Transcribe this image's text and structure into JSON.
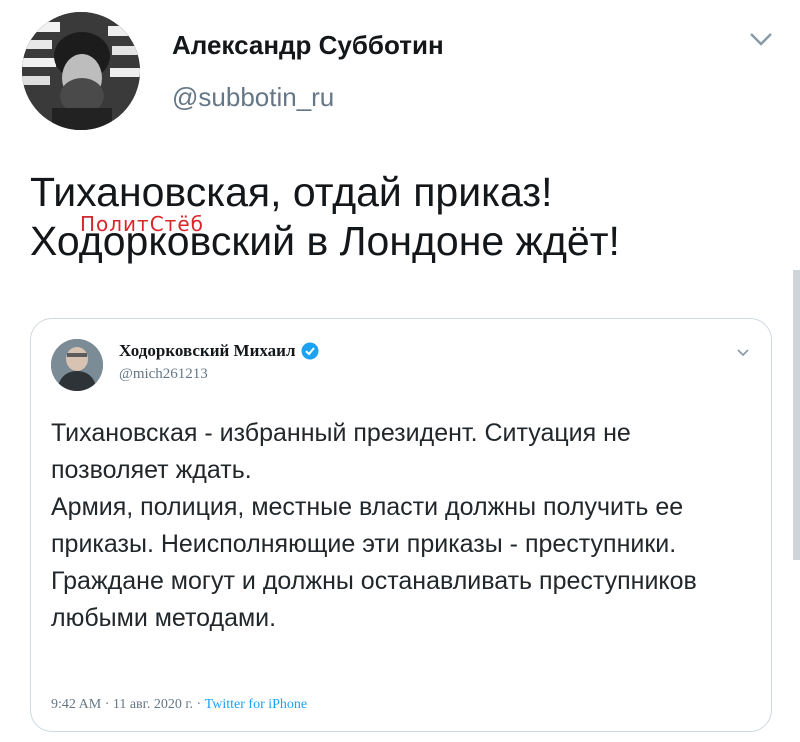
{
  "author": {
    "name": "Александр Субботин",
    "handle": "@subbotin_ru"
  },
  "tweet": {
    "lines": [
      "Тихановская, отдай приказ!",
      "Ходорковский в Лондоне ждёт!"
    ]
  },
  "watermark": "ПолитСтёб",
  "quoted_tweet": {
    "author_name": "Ходорковский Михаил",
    "author_handle": "@mich261213",
    "paragraphs": [
      "Тихановская - избранный президент. Ситуация не позволяет ждать.",
      "Армия, полиция, местные власти должны получить ее приказы. Неисполняющие эти приказы - преступники.",
      "Граждане могут и должны останавливать преступников любыми методами."
    ],
    "time": "9:42 AM",
    "date": "11 авг. 2020 г.",
    "source": "Twitter for iPhone",
    "separator": " · "
  },
  "icons": {
    "menu": "chevron-down-icon",
    "verified": "verified-badge-icon"
  },
  "colors": {
    "accent": "#1da1f2",
    "secondary_text": "#657786",
    "watermark": "#d9262b"
  }
}
